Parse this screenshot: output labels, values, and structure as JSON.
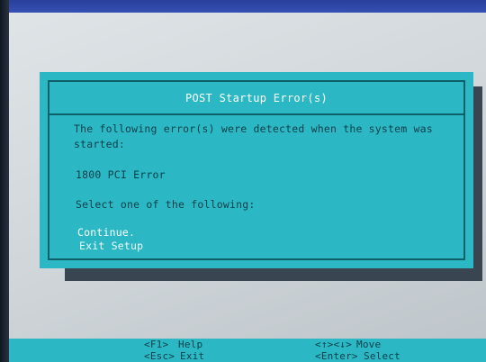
{
  "dialog": {
    "title": "POST Startup Error(s)",
    "message_line1": "The following error(s) were detected when the system was",
    "message_line2": "started:",
    "error_code": "1800 PCI Error",
    "prompt": "Select one of the following:",
    "options": [
      {
        "label": "Continue.",
        "selected": true
      },
      {
        "label": "Exit Setup",
        "selected": false
      }
    ]
  },
  "footer": {
    "f1_key": "<F1>",
    "f1_label": "Help",
    "esc_key": "<Esc>",
    "esc_label": "Exit",
    "arrows_key": "<↑><↓>",
    "arrows_label": "Move",
    "enter_key": "<Enter>",
    "enter_label": "Select"
  },
  "colors": {
    "dialog_bg": "#2bb8c4",
    "frame": "#0d5f6a",
    "text": "#0b3f48",
    "highlight_text": "#ffffff",
    "top_bar": "#3550b5"
  }
}
